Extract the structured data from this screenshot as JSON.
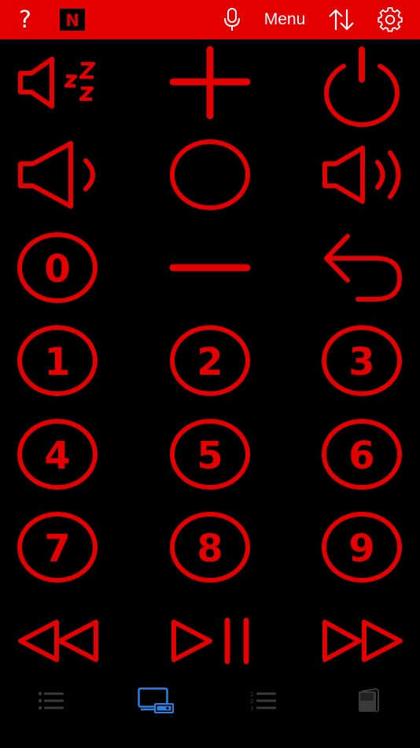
{
  "topbar": {
    "help_label": "?",
    "netflix_label": "N",
    "menu_label": "Menu",
    "icons": [
      "help",
      "netflix-icon",
      "microphone-icon",
      "sort-arrows-icon",
      "gear-icon"
    ]
  },
  "remote": {
    "icons": [
      "mute-icon",
      "channel-up-icon",
      "power-icon",
      "volume-down-icon",
      "ok-icon",
      "volume-up-icon",
      "channel-down-icon",
      "back-icon",
      "rewind-icon",
      "play-pause-icon",
      "fast-forward-icon"
    ],
    "digits": [
      "0",
      "1",
      "2",
      "3",
      "4",
      "5",
      "6",
      "7",
      "8",
      "9"
    ]
  },
  "tabbar": {
    "tabs": [
      "list-icon",
      "remote-device-icon",
      "numbered-list-icon",
      "book-icon"
    ],
    "active_tab": "remote-device-icon"
  },
  "colors": {
    "accent": "#e40000",
    "background": "#000000",
    "tab_active": "#2f7fe0",
    "tab_inactive": "#3a3a3a"
  }
}
